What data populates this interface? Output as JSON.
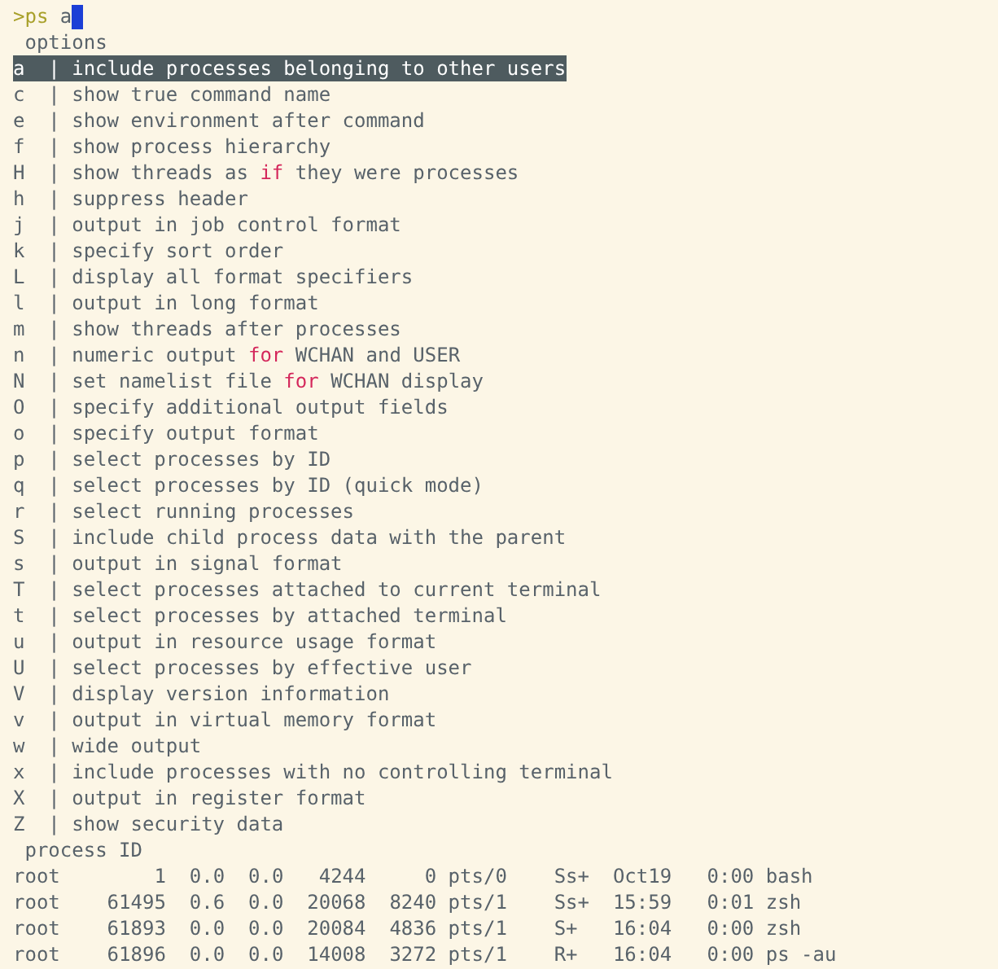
{
  "prompt": {
    "symbol": ">",
    "command": "ps",
    "argument": "a",
    "cursor": true
  },
  "options_header": "options",
  "separator": "|",
  "options": [
    {
      "key": "a",
      "description": [
        {
          "text": "include processes belonging to other users"
        }
      ],
      "selected": true
    },
    {
      "key": "c",
      "description": [
        {
          "text": "show true command name"
        }
      ],
      "selected": false
    },
    {
      "key": "e",
      "description": [
        {
          "text": "show environment after command"
        }
      ],
      "selected": false
    },
    {
      "key": "f",
      "description": [
        {
          "text": "show process hierarchy"
        }
      ],
      "selected": false
    },
    {
      "key": "H",
      "description": [
        {
          "text": "show threads as "
        },
        {
          "text": "if",
          "kind": "keyword"
        },
        {
          "text": " they were processes"
        }
      ],
      "selected": false
    },
    {
      "key": "h",
      "description": [
        {
          "text": "suppress header"
        }
      ],
      "selected": false
    },
    {
      "key": "j",
      "description": [
        {
          "text": "output in job control format"
        }
      ],
      "selected": false
    },
    {
      "key": "k",
      "description": [
        {
          "text": "specify sort order"
        }
      ],
      "selected": false
    },
    {
      "key": "L",
      "description": [
        {
          "text": "display all format specifiers"
        }
      ],
      "selected": false
    },
    {
      "key": "l",
      "description": [
        {
          "text": "output in long format"
        }
      ],
      "selected": false
    },
    {
      "key": "m",
      "description": [
        {
          "text": "show threads after processes"
        }
      ],
      "selected": false
    },
    {
      "key": "n",
      "description": [
        {
          "text": "numeric output "
        },
        {
          "text": "for",
          "kind": "keyword"
        },
        {
          "text": " WCHAN and USER"
        }
      ],
      "selected": false
    },
    {
      "key": "N",
      "description": [
        {
          "text": "set namelist file "
        },
        {
          "text": "for",
          "kind": "keyword"
        },
        {
          "text": " WCHAN display"
        }
      ],
      "selected": false
    },
    {
      "key": "O",
      "description": [
        {
          "text": "specify additional output fields"
        }
      ],
      "selected": false
    },
    {
      "key": "o",
      "description": [
        {
          "text": "specify output format"
        }
      ],
      "selected": false
    },
    {
      "key": "p",
      "description": [
        {
          "text": "select processes by ID"
        }
      ],
      "selected": false
    },
    {
      "key": "q",
      "description": [
        {
          "text": "select processes by ID (quick mode)"
        }
      ],
      "selected": false
    },
    {
      "key": "r",
      "description": [
        {
          "text": "select running processes"
        }
      ],
      "selected": false
    },
    {
      "key": "S",
      "description": [
        {
          "text": "include child process data with the parent"
        }
      ],
      "selected": false
    },
    {
      "key": "s",
      "description": [
        {
          "text": "output in signal format"
        }
      ],
      "selected": false
    },
    {
      "key": "T",
      "description": [
        {
          "text": "select processes attached to current terminal"
        }
      ],
      "selected": false
    },
    {
      "key": "t",
      "description": [
        {
          "text": "select processes by attached terminal"
        }
      ],
      "selected": false
    },
    {
      "key": "u",
      "description": [
        {
          "text": "output in resource usage format"
        }
      ],
      "selected": false
    },
    {
      "key": "U",
      "description": [
        {
          "text": "select processes by effective user"
        }
      ],
      "selected": false
    },
    {
      "key": "V",
      "description": [
        {
          "text": "display version information"
        }
      ],
      "selected": false
    },
    {
      "key": "v",
      "description": [
        {
          "text": "output in virtual memory format"
        }
      ],
      "selected": false
    },
    {
      "key": "w",
      "description": [
        {
          "text": "wide output"
        }
      ],
      "selected": false
    },
    {
      "key": "x",
      "description": [
        {
          "text": "include processes with no controlling terminal"
        }
      ],
      "selected": false
    },
    {
      "key": "X",
      "description": [
        {
          "text": "output in register format"
        }
      ],
      "selected": false
    },
    {
      "key": "Z",
      "description": [
        {
          "text": "show security data"
        }
      ],
      "selected": false
    }
  ],
  "process_header": "process ID",
  "process_lines": [
    "root        1  0.0  0.0   4244     0 pts/0    Ss+  Oct19   0:00 bash",
    "root    61495  0.6  0.0  20068  8240 pts/1    Ss+  15:59   0:01 zsh",
    "root    61893  0.0  0.0  20084  4836 pts/1    S+   16:04   0:00 zsh",
    "root    61896  0.0  0.0  14008  3272 pts/1    R+   16:04   0:00 ps -au"
  ]
}
